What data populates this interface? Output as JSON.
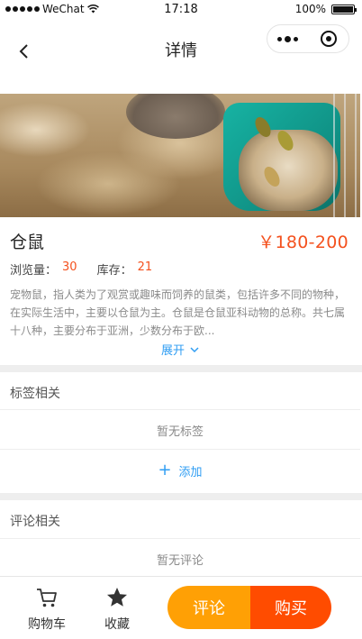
{
  "status_bar": {
    "carrier": "WeChat",
    "time": "17:18",
    "battery": "100%",
    "battery_level": 1.0,
    "icons": [
      "signal-dots-icon",
      "wifi-icon",
      "battery-icon"
    ]
  },
  "nav": {
    "title": "详情",
    "back_icon": "chevron-left-icon",
    "menu_icon": "more-dots-icon",
    "close_icon": "target-ring-icon"
  },
  "banner": {
    "slide_count": 3,
    "active_index": 0,
    "colors": {
      "active_indicator": "#2f9df3",
      "bowl": "#17b3a3"
    }
  },
  "product": {
    "name": "仓鼠",
    "price": "￥180-200",
    "views_label": "浏览量：",
    "views_value": "30",
    "stock_label": "库存：",
    "stock_value": "21",
    "description": "宠物鼠，指人类为了观赏或趣味而饲养的鼠类，包括许多不同的物种，在实际生活中，主要以仓鼠为主。仓鼠是仓鼠亚科动物的总称。共七属十八种，主要分布于亚洲，少数分布于欧...",
    "expand_label": "展开",
    "expand_icon": "chevron-down-icon"
  },
  "tags": {
    "title": "标签相关",
    "empty_text": "暂无标签",
    "add_label": "添加",
    "add_icon": "plus-icon"
  },
  "comments": {
    "title": "评论相关",
    "empty_text": "暂无评论"
  },
  "bottom_bar": {
    "cart_label": "购物车",
    "cart_icon": "cart-icon",
    "fav_label": "收藏",
    "fav_icon": "star-icon",
    "comment_label": "评论",
    "buy_label": "购买"
  },
  "colors": {
    "accent": "#2f9df3",
    "price": "#f4511e",
    "comment_button": "#ffa005",
    "buy_button": "#ff4c00",
    "divider": "#eeeeee"
  }
}
